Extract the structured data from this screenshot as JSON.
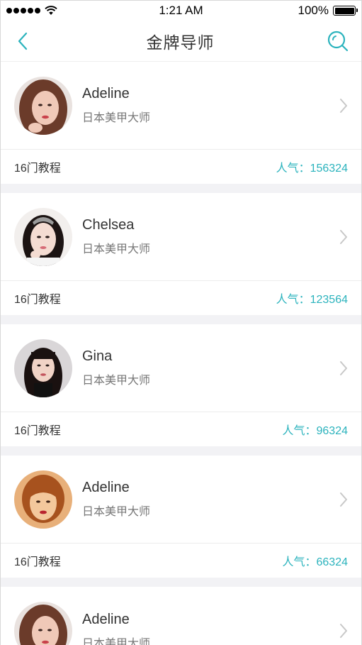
{
  "status_bar": {
    "time": "1:21 AM",
    "battery": "100%"
  },
  "nav": {
    "title": "金牌导师",
    "back_icon": "chevron-left-icon",
    "search_icon": "search-icon",
    "accent_color": "#2bb3bd"
  },
  "teachers": [
    {
      "name": "Adeline",
      "title": "日本美甲大师",
      "courses": "16门教程",
      "popularity": "人气：156324",
      "avatar": {
        "skin": "#f0c9b8",
        "hair": "#6b3b2a",
        "bg": "#e9e2df"
      }
    },
    {
      "name": "Chelsea",
      "title": "日本美甲大师",
      "courses": "16门教程",
      "popularity": "人气：123564",
      "avatar": {
        "skin": "#f4dcd2",
        "hair": "#1c1413",
        "bg": "#f2efed"
      }
    },
    {
      "name": "Gina",
      "title": "日本美甲大师",
      "courses": "16门教程",
      "popularity": "人气：96324",
      "avatar": {
        "skin": "#f1d3c6",
        "hair": "#1a1110",
        "bg": "#d9d6d8"
      }
    },
    {
      "name": "Adeline",
      "title": "日本美甲大师",
      "courses": "16门教程",
      "popularity": "人气：66324",
      "avatar": {
        "skin": "#f3c89c",
        "hair": "#a7521e",
        "bg": "#e8b07a"
      }
    },
    {
      "name": "Adeline",
      "title": "日本美甲大师",
      "courses": "",
      "popularity": "",
      "avatar": {
        "skin": "#f0c9b8",
        "hair": "#6b3b2a",
        "bg": "#e9e2df"
      }
    }
  ]
}
